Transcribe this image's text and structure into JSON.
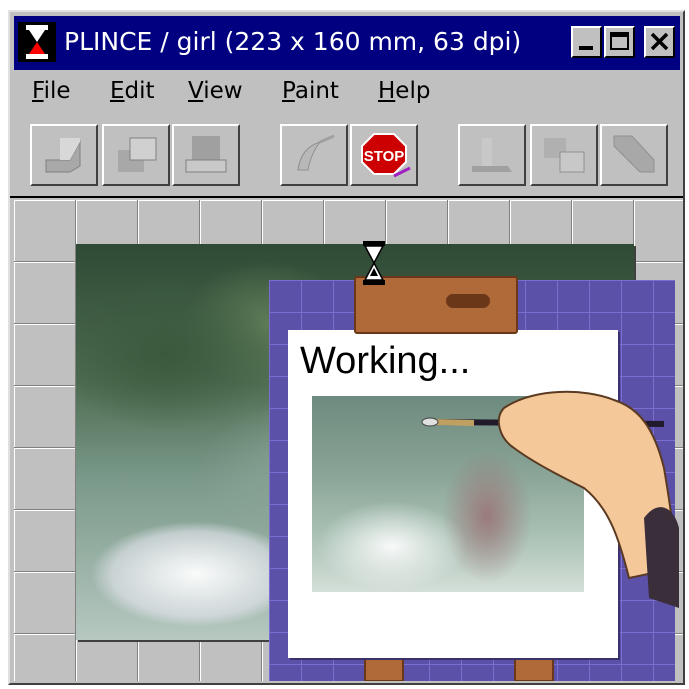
{
  "window": {
    "title": "PLINCE / girl (223 x 160 mm, 63 dpi)"
  },
  "menu": {
    "items": [
      {
        "mnemonic": "F",
        "rest": "ile"
      },
      {
        "mnemonic": "E",
        "rest": "dit"
      },
      {
        "mnemonic": "V",
        "rest": "iew"
      },
      {
        "mnemonic": "P",
        "rest": "aint"
      },
      {
        "mnemonic": "H",
        "rest": "elp"
      }
    ]
  },
  "toolbar": {
    "stop_label": "STOP"
  },
  "status": {
    "working_text": "Working..."
  },
  "colors": {
    "titlebar": "#000080",
    "window_face": "#c0c0c0",
    "easel": "#5b51a9",
    "stop_red": "#cc0000"
  },
  "icons": [
    "hourglass-icon",
    "minimize-icon",
    "maximize-icon",
    "close-icon",
    "stop-icon",
    "brush-icon"
  ]
}
